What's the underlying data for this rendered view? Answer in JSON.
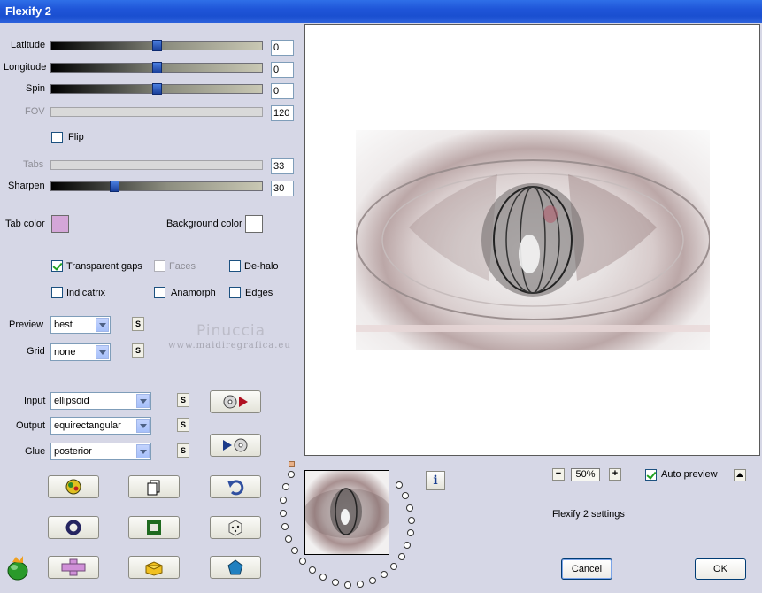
{
  "window": {
    "title": "Flexify 2"
  },
  "sliders": {
    "latitude": {
      "label": "Latitude",
      "value": "0",
      "level": 0.5
    },
    "longitude": {
      "label": "Longitude",
      "value": "0",
      "level": 0.5
    },
    "spin": {
      "label": "Spin",
      "value": "0",
      "level": 0.5
    },
    "fov": {
      "label": "FOV",
      "value": "120"
    },
    "tabs": {
      "label": "Tabs",
      "value": "33"
    },
    "sharpen": {
      "label": "Sharpen",
      "value": "30",
      "level": 0.3
    }
  },
  "checkboxes": {
    "flip": {
      "label": "Flip",
      "checked": false
    },
    "transparent_gaps": {
      "label": "Transparent gaps",
      "checked": true
    },
    "faces": {
      "label": "Faces",
      "checked": false
    },
    "de_halo": {
      "label": "De-halo",
      "checked": false
    },
    "indicatrix": {
      "label": "Indicatrix",
      "checked": false
    },
    "anamorph": {
      "label": "Anamorph",
      "checked": false
    },
    "edges": {
      "label": "Edges",
      "checked": false
    },
    "auto_preview": {
      "label": "Auto preview",
      "checked": true
    }
  },
  "colors": {
    "tab_color_label": "Tab color",
    "tab_color": "#d4a6d8",
    "background_color_label": "Background color",
    "background_color": "#ffffff"
  },
  "selects": {
    "preview": {
      "label": "Preview",
      "value": "best"
    },
    "grid": {
      "label": "Grid",
      "value": "none"
    },
    "input": {
      "label": "Input",
      "value": "ellipsoid"
    },
    "output": {
      "label": "Output",
      "value": "equirectangular"
    },
    "glue": {
      "label": "Glue",
      "value": "posterior"
    }
  },
  "small_button_label": "S",
  "watermark": {
    "line1": "Pinuccia",
    "line2": "www.maidiregrafica.eu"
  },
  "zoom": {
    "value": "50%",
    "minus": "−",
    "plus": "+"
  },
  "info_button_label": "i",
  "status_text": "Flexify 2 settings",
  "buttons": {
    "cancel": "Cancel",
    "ok": "OK"
  }
}
